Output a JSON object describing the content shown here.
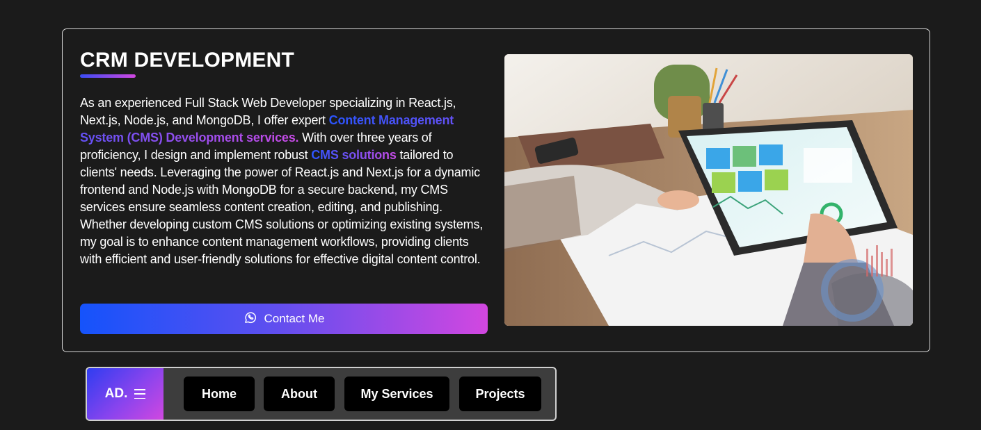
{
  "section": {
    "title": "CRM DEVELOPMENT",
    "paragraph": {
      "part1": "As an experienced Full Stack Web Developer specializing in React.js, Next.js, Node.js, and MongoDB, I offer expert ",
      "highlight1": "Content Management System (CMS) Development services.",
      "part2": " With over three years of proficiency, I design and implement robust ",
      "highlight2": "CMS solutions",
      "part3": " tailored to clients' needs. Leveraging the power of React.js and Next.js for a dynamic frontend and Node.js with MongoDB for a secure backend, my CMS services ensure seamless content creation, editing, and publishing. Whether developing custom CMS solutions or optimizing existing systems, my goal is to enhance content management workflows, providing clients with efficient and user-friendly solutions for effective digital content control."
    },
    "cta": {
      "label": "Contact Me",
      "icon": "whatsapp-icon"
    },
    "image": {
      "description": "hands using tablet with analytics dashboard on desk"
    }
  },
  "nav": {
    "brand": "AD.",
    "menu_icon": "hamburger-icon",
    "items": [
      {
        "label": "Home"
      },
      {
        "label": "About"
      },
      {
        "label": "My Services"
      },
      {
        "label": "Projects"
      }
    ]
  },
  "colors": {
    "background": "#1b1b1b",
    "gradient_start": "#1553fb",
    "gradient_end": "#d247e0",
    "nav_bg": "#3d3d3d",
    "nav_button": "#000000"
  }
}
